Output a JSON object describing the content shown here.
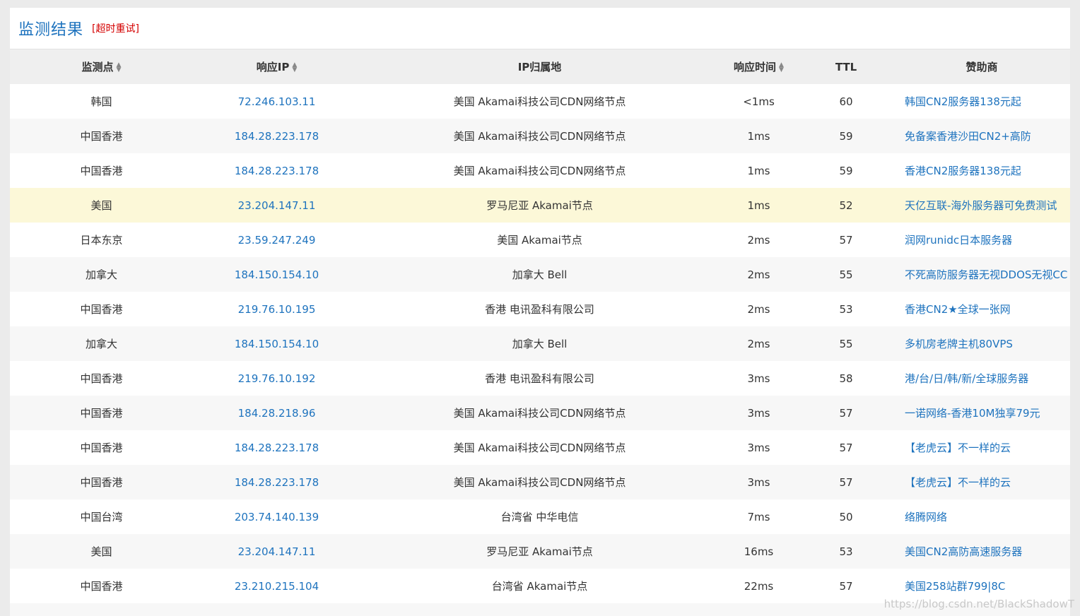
{
  "header": {
    "title": "监测结果",
    "retry_label": "[超时重试]"
  },
  "columns": {
    "location": "监测点",
    "ip": "响应IP",
    "ip_location": "IP归属地",
    "time": "响应时间",
    "ttl": "TTL",
    "sponsor": "赞助商"
  },
  "rows": [
    {
      "location": "韩国",
      "ip": "72.246.103.11",
      "ip_location": "美国 Akamai科技公司CDN网络节点",
      "time": "<1ms",
      "ttl": "60",
      "sponsor": "韩国CN2服务器138元起"
    },
    {
      "location": "中国香港",
      "ip": "184.28.223.178",
      "ip_location": "美国 Akamai科技公司CDN网络节点",
      "time": "1ms",
      "ttl": "59",
      "sponsor": "免备案香港沙田CN2+高防"
    },
    {
      "location": "中国香港",
      "ip": "184.28.223.178",
      "ip_location": "美国 Akamai科技公司CDN网络节点",
      "time": "1ms",
      "ttl": "59",
      "sponsor": "香港CN2服务器138元起"
    },
    {
      "location": "美国",
      "ip": "23.204.147.11",
      "ip_location": "罗马尼亚 Akamai节点",
      "time": "1ms",
      "ttl": "52",
      "sponsor": "天亿互联-海外服务器可免费测试"
    },
    {
      "location": "日本东京",
      "ip": "23.59.247.249",
      "ip_location": "美国 Akamai节点",
      "time": "2ms",
      "ttl": "57",
      "sponsor": "润网runidc日本服务器"
    },
    {
      "location": "加拿大",
      "ip": "184.150.154.10",
      "ip_location": "加拿大 Bell",
      "time": "2ms",
      "ttl": "55",
      "sponsor": "不死高防服务器无视DDOS无视CC"
    },
    {
      "location": "中国香港",
      "ip": "219.76.10.195",
      "ip_location": "香港 电讯盈科有限公司",
      "time": "2ms",
      "ttl": "53",
      "sponsor": "香港CN2★全球一张网"
    },
    {
      "location": "加拿大",
      "ip": "184.150.154.10",
      "ip_location": "加拿大 Bell",
      "time": "2ms",
      "ttl": "55",
      "sponsor": "多机房老牌主机80VPS"
    },
    {
      "location": "中国香港",
      "ip": "219.76.10.192",
      "ip_location": "香港 电讯盈科有限公司",
      "time": "3ms",
      "ttl": "58",
      "sponsor": "港/台/日/韩/新/全球服务器"
    },
    {
      "location": "中国香港",
      "ip": "184.28.218.96",
      "ip_location": "美国 Akamai科技公司CDN网络节点",
      "time": "3ms",
      "ttl": "57",
      "sponsor": "一诺网络-香港10M独享79元"
    },
    {
      "location": "中国香港",
      "ip": "184.28.223.178",
      "ip_location": "美国 Akamai科技公司CDN网络节点",
      "time": "3ms",
      "ttl": "57",
      "sponsor": "【老虎云】不一样的云"
    },
    {
      "location": "中国香港",
      "ip": "184.28.223.178",
      "ip_location": "美国 Akamai科技公司CDN网络节点",
      "time": "3ms",
      "ttl": "57",
      "sponsor": "【老虎云】不一样的云"
    },
    {
      "location": "中国台湾",
      "ip": "203.74.140.139",
      "ip_location": "台湾省 中华电信",
      "time": "7ms",
      "ttl": "50",
      "sponsor": "络腾网络"
    },
    {
      "location": "美国",
      "ip": "23.204.147.11",
      "ip_location": "罗马尼亚 Akamai节点",
      "time": "16ms",
      "ttl": "53",
      "sponsor": "美国CN2高防高速服务器"
    },
    {
      "location": "中国香港",
      "ip": "23.210.215.104",
      "ip_location": "台湾省 Akamai节点",
      "time": "22ms",
      "ttl": "57",
      "sponsor": "美国258站群799|8C"
    }
  ],
  "watermark": "https://blog.csdn.net/BlackShadowT"
}
